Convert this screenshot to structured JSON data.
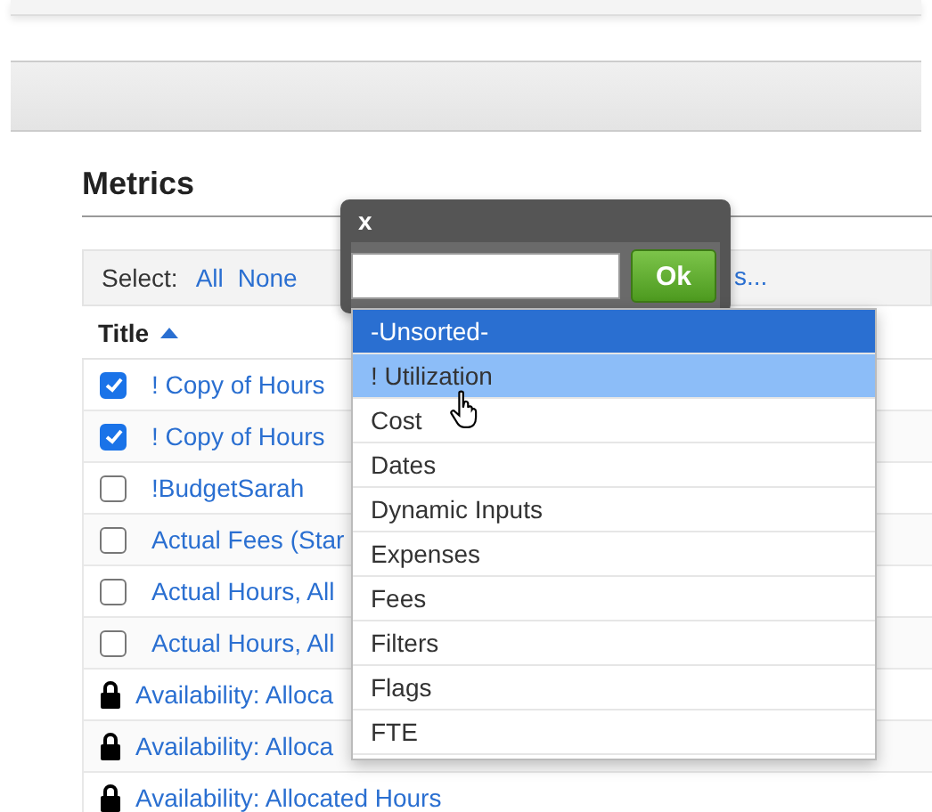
{
  "heading": "Metrics",
  "select_bar": {
    "label": "Select:",
    "links": [
      "All",
      "None"
    ],
    "trailing_link": "s..."
  },
  "table": {
    "columns": [
      {
        "label": "Title",
        "sort_ascending": true
      }
    ],
    "rows": [
      {
        "kind": "checkbox",
        "checked": true,
        "title": "! Copy of Hours"
      },
      {
        "kind": "checkbox",
        "checked": true,
        "title": "! Copy of Hours"
      },
      {
        "kind": "checkbox",
        "checked": false,
        "title": "!BudgetSarah"
      },
      {
        "kind": "checkbox",
        "checked": false,
        "title": "Actual Fees (Star"
      },
      {
        "kind": "checkbox",
        "checked": false,
        "title": "Actual Hours, All"
      },
      {
        "kind": "checkbox",
        "checked": false,
        "title": "Actual Hours, All"
      },
      {
        "kind": "locked",
        "title": "Availability: Alloca"
      },
      {
        "kind": "locked",
        "title": "Availability: Alloca"
      },
      {
        "kind": "locked",
        "title": "Availability: Allocated Hours"
      }
    ]
  },
  "popup": {
    "close": "x",
    "ok_button": "Ok",
    "options": [
      {
        "label": "-Unsorted-",
        "selected": true,
        "hovered": false
      },
      {
        "label": "! Utilization",
        "selected": false,
        "hovered": true
      },
      {
        "label": "Cost",
        "selected": false,
        "hovered": false
      },
      {
        "label": "Dates",
        "selected": false,
        "hovered": false
      },
      {
        "label": "Dynamic Inputs",
        "selected": false,
        "hovered": false
      },
      {
        "label": "Expenses",
        "selected": false,
        "hovered": false
      },
      {
        "label": "Fees",
        "selected": false,
        "hovered": false
      },
      {
        "label": "Filters",
        "selected": false,
        "hovered": false
      },
      {
        "label": "Flags",
        "selected": false,
        "hovered": false
      },
      {
        "label": "FTE",
        "selected": false,
        "hovered": false
      }
    ]
  }
}
